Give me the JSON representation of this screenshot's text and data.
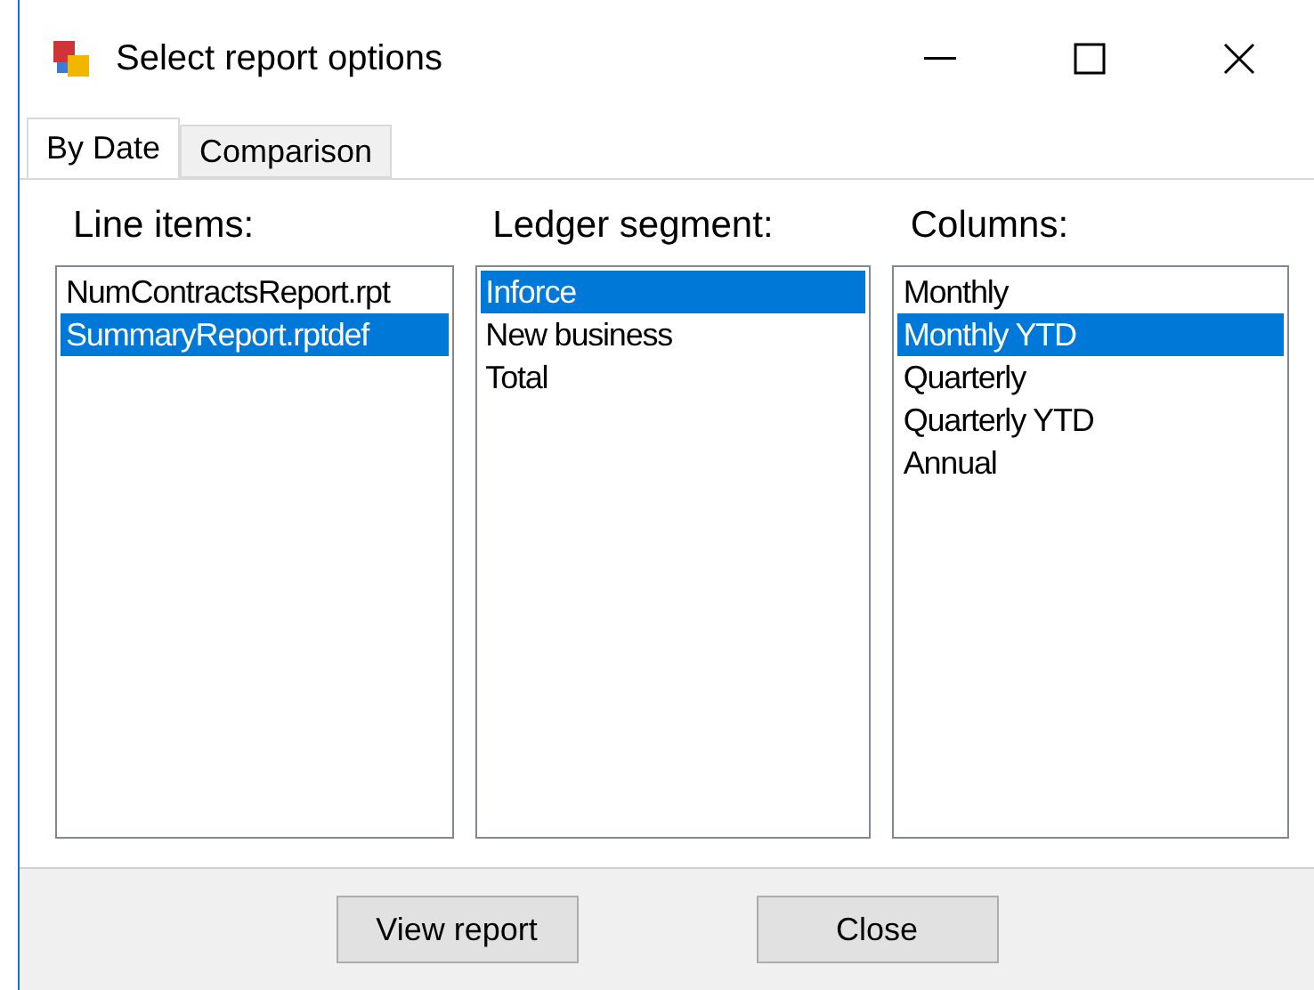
{
  "window": {
    "title": "Select report options"
  },
  "tabs": [
    {
      "label": "By Date",
      "selected": true
    },
    {
      "label": "Comparison",
      "selected": false
    }
  ],
  "lists": [
    {
      "label": "Line items:",
      "items": [
        {
          "text": "NumContractsReport.rpt",
          "selected": false
        },
        {
          "text": "SummaryReport.rptdef",
          "selected": true
        }
      ]
    },
    {
      "label": "Ledger segment:",
      "items": [
        {
          "text": "Inforce",
          "selected": true
        },
        {
          "text": "New business",
          "selected": false
        },
        {
          "text": "Total",
          "selected": false
        }
      ]
    },
    {
      "label": "Columns:",
      "items": [
        {
          "text": "Monthly",
          "selected": false
        },
        {
          "text": "Monthly YTD",
          "selected": true
        },
        {
          "text": "Quarterly",
          "selected": false
        },
        {
          "text": "Quarterly YTD",
          "selected": false
        },
        {
          "text": "Annual",
          "selected": false
        }
      ]
    }
  ],
  "buttons": [
    "View report",
    "Close"
  ]
}
